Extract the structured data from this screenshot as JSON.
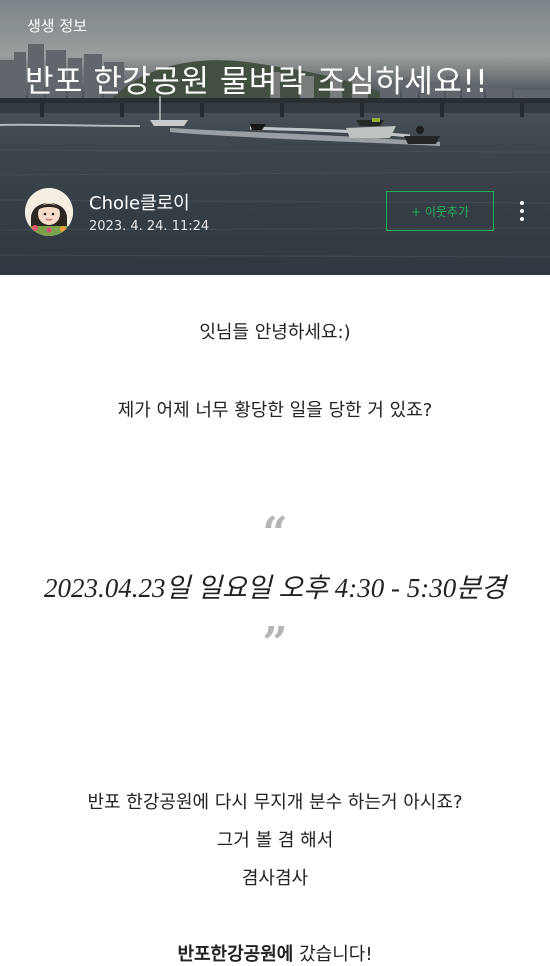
{
  "header": {
    "category": "생생 정보",
    "title": "반포 한강공원 물벼락 조심하세요!!",
    "author_name": "Chole클로이",
    "date": "2023. 4. 24. 11:24",
    "add_neighbor_label": "+ 이웃추가"
  },
  "body": {
    "greeting": "잇님들 안녕하세요:)",
    "intro": "제가 어제 너무 황당한 일을 당한 거 있죠?",
    "quote_open": "“",
    "quote": "2023.04.23일 일요일 오후 4:30 - 5:30분경",
    "quote_close": "”",
    "line1": "반포 한강공원에 다시 무지개 분수 하는거 아시죠?",
    "line2": "그거 볼 겸 해서",
    "line3": "겸사겸사",
    "line4_bold": "반포한강공원에",
    "line4_rest": " 갔습니다!"
  },
  "colors": {
    "accent_green": "#1fb15a"
  },
  "icons": {
    "more": "more-vertical-icon"
  }
}
